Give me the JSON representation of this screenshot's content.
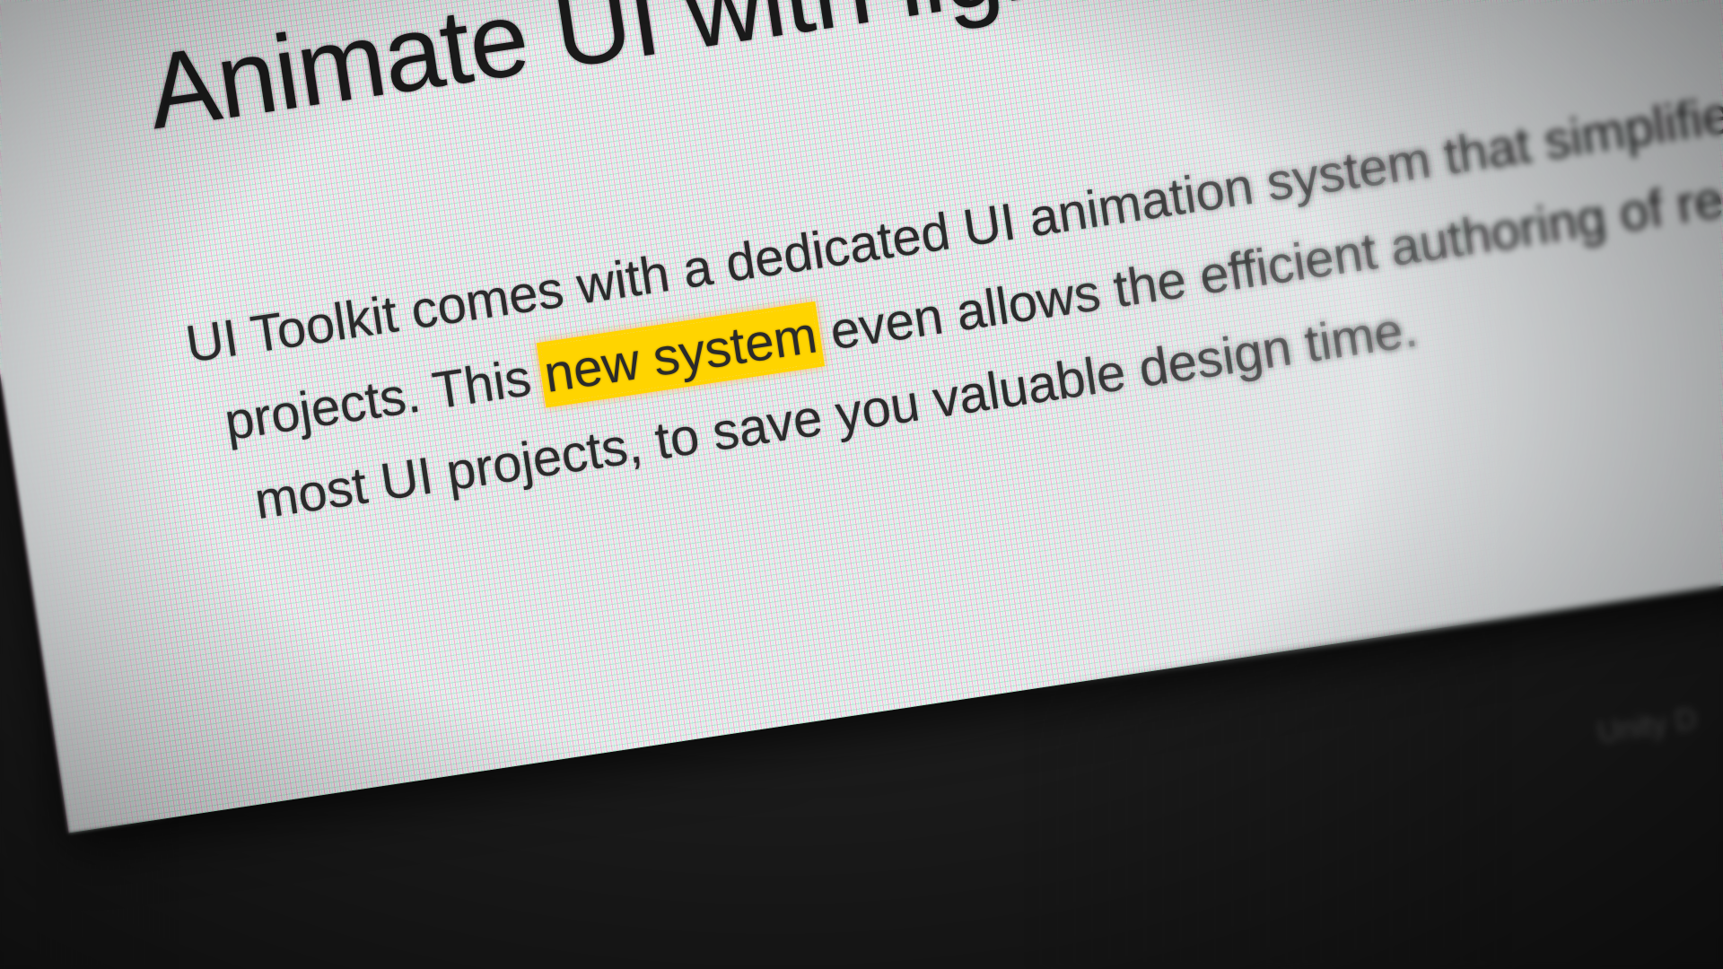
{
  "article": {
    "title": "Animate UI with lightweight transitions",
    "body": {
      "line1": "UI Toolkit comes with a dedicated UI animation system that simplifies the",
      "line2_before": "projects. This ",
      "line2_highlight": "new system",
      "line2_after": " even allows the efficient authoring of reusable",
      "line3": "most UI projects, to save you valuable design time."
    },
    "highlight_color": "#ffd400"
  },
  "footer": {
    "text": "Unity D"
  }
}
